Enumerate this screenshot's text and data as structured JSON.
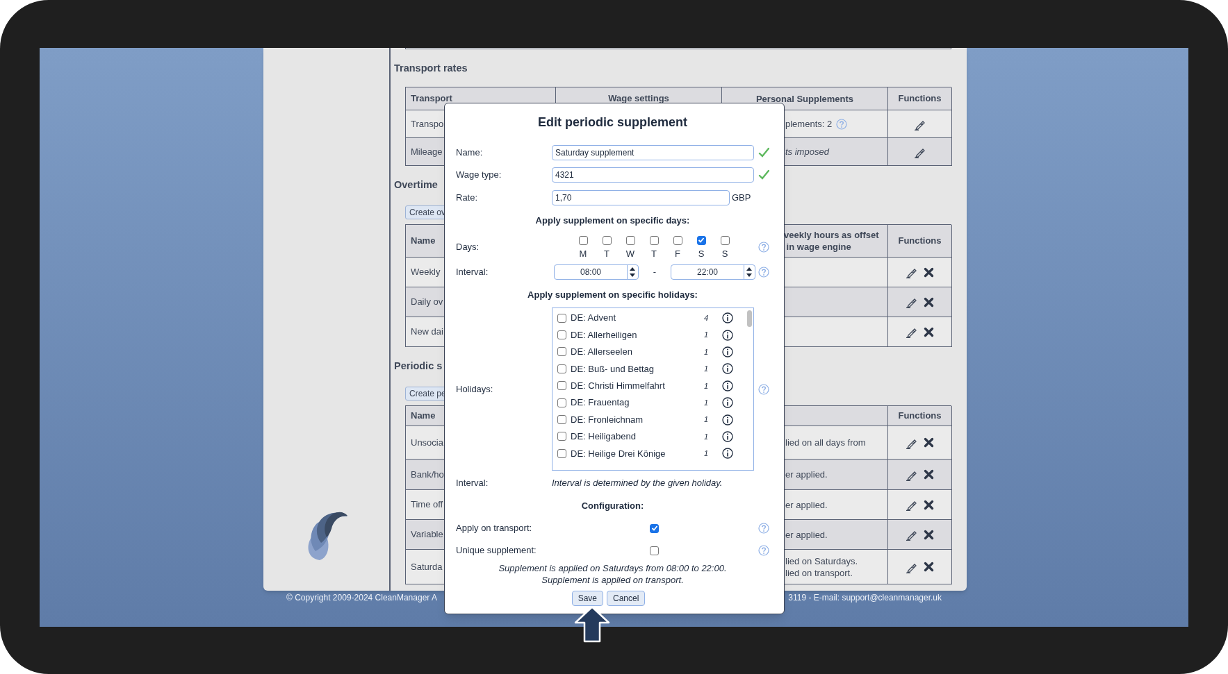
{
  "page": {
    "sections": [
      {
        "heading": "Transport rates",
        "header": {
          "name": "Transport",
          "middle": "Wage settings",
          "details": "Personal Supplements",
          "functions": "Functions"
        },
        "rows": [
          {
            "name": "Transpo",
            "details": "plements: 2",
            "help": true,
            "italic": false,
            "edit": true,
            "delete": false
          },
          {
            "name": "Mileage",
            "details": "ts imposed",
            "help": false,
            "italic": true,
            "edit": true,
            "delete": false
          }
        ]
      },
      {
        "heading": "Overtime",
        "create_button": "Create ov",
        "header": {
          "name": "Name",
          "details": "veekly hours as offset\n in wage engine",
          "functions": "Functions"
        },
        "rows": [
          {
            "name": "Weekly",
            "edit": true,
            "delete": true
          },
          {
            "name": "Daily ov",
            "edit": true,
            "delete": true
          },
          {
            "name": "New dai",
            "edit": true,
            "delete": true
          }
        ]
      },
      {
        "heading": "Periodic s",
        "create_button": "Create pe",
        "header": {
          "name": "Name",
          "functions": "Functions"
        },
        "rows": [
          {
            "name": "Unsocia",
            "details": "lied on all days from",
            "edit": true,
            "delete": true
          },
          {
            "name": "Bank/ho",
            "details": "er applied.",
            "edit": true,
            "delete": true
          },
          {
            "name": "Time off",
            "details": "er applied.",
            "edit": true,
            "delete": true
          },
          {
            "name": "Variable",
            "details": "er applied.",
            "edit": true,
            "delete": true
          },
          {
            "name": "Saturda",
            "details": "lied on Saturdays.\nlied on transport.",
            "edit": true,
            "delete": true
          }
        ]
      }
    ],
    "footer_left": "© Copyright 2009-2024 CleanManager A",
    "footer_right": "3119 - E-mail: support@cleanmanager.uk"
  },
  "dialog": {
    "title": "Edit periodic supplement",
    "fields": [
      {
        "label": "Name:",
        "value": "Saturday supplement",
        "valid": true
      },
      {
        "label": "Wage type:",
        "value": "4321",
        "valid": true
      }
    ],
    "rate": {
      "label": "Rate:",
      "value": "1,70",
      "unit": "GBP"
    },
    "days_heading": "Apply supplement on specific days:",
    "days": {
      "label": "Days:",
      "items": [
        {
          "letter": "M",
          "checked": false
        },
        {
          "letter": "T",
          "checked": false
        },
        {
          "letter": "W",
          "checked": false
        },
        {
          "letter": "T",
          "checked": false
        },
        {
          "letter": "F",
          "checked": false
        },
        {
          "letter": "S",
          "checked": true
        },
        {
          "letter": "S",
          "checked": false
        }
      ]
    },
    "interval": {
      "label": "Interval:",
      "from": "08:00",
      "separator": "-",
      "to": "22:00"
    },
    "holidays_heading": "Apply supplement on specific holidays:",
    "holidays": {
      "label": "Holidays:",
      "items": [
        {
          "name": "DE: Advent",
          "count": "4",
          "checked": false
        },
        {
          "name": "DE: Allerheiligen",
          "count": "1",
          "checked": false
        },
        {
          "name": "DE: Allerseelen",
          "count": "1",
          "checked": false
        },
        {
          "name": "DE: Buß- und Bettag",
          "count": "1",
          "checked": false
        },
        {
          "name": "DE: Christi Himmelfahrt",
          "count": "1",
          "checked": false
        },
        {
          "name": "DE: Frauentag",
          "count": "1",
          "checked": false
        },
        {
          "name": "DE: Fronleichnam",
          "count": "1",
          "checked": false
        },
        {
          "name": "DE: Heiligabend",
          "count": "1",
          "checked": false
        },
        {
          "name": "DE: Heilige Drei Könige",
          "count": "1",
          "checked": false
        }
      ]
    },
    "holiday_interval": {
      "label": "Interval:",
      "text": "Interval is determined by the given holiday."
    },
    "config_heading": "Configuration:",
    "options": [
      {
        "label": "Apply on transport:",
        "checked": true
      },
      {
        "label": "Unique supplement:",
        "checked": false
      }
    ],
    "summary": [
      "Supplement is applied on Saturdays from 08:00 to 22:00.",
      "Supplement is applied on transport."
    ],
    "buttons": [
      {
        "label": "Save"
      },
      {
        "label": "Cancel"
      }
    ]
  }
}
